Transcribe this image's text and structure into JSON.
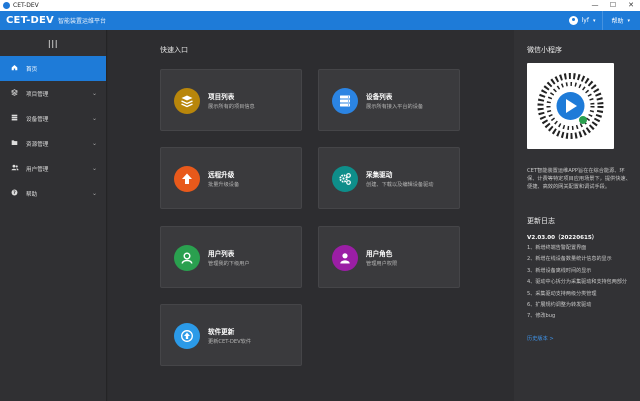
{
  "window": {
    "title": "CET-DEV",
    "minimize": "—",
    "maximize": "☐",
    "close": "✕"
  },
  "header": {
    "logo": "CET-DEV",
    "subtitle": "智能装置运维平台",
    "user": "lyf",
    "help": "帮助",
    "accent": "#1e7bd8"
  },
  "sidebar": {
    "collapse_glyph": "|||",
    "items": [
      {
        "label": "首页",
        "icon": "home-icon",
        "active": true,
        "has_children": false
      },
      {
        "label": "项目管理",
        "icon": "layers-icon",
        "active": false,
        "has_children": true
      },
      {
        "label": "设备管理",
        "icon": "server-icon",
        "active": false,
        "has_children": true
      },
      {
        "label": "资源管理",
        "icon": "folder-icon",
        "active": false,
        "has_children": true
      },
      {
        "label": "用户管理",
        "icon": "users-icon",
        "active": false,
        "has_children": true
      },
      {
        "label": "帮助",
        "icon": "help-icon",
        "active": false,
        "has_children": true
      }
    ]
  },
  "quick": {
    "title": "快速入口",
    "cards": [
      {
        "name": "项目列表",
        "desc": "展示所有的项目信息",
        "icon": "layers-icon",
        "color": "#b8860b"
      },
      {
        "name": "设备列表",
        "desc": "展示所有接入平台的设备",
        "icon": "server-icon",
        "color": "#2b84e3"
      },
      {
        "name": "远程升级",
        "desc": "批量升级设备",
        "icon": "upload-icon",
        "color": "#e8591b"
      },
      {
        "name": "采集驱动",
        "desc": "创建、下载以及编辑设备驱动",
        "icon": "gears-icon",
        "color": "#0e8e8a"
      },
      {
        "name": "用户列表",
        "desc": "管理我的下级用户",
        "icon": "user-icon",
        "color": "#2aa04f"
      },
      {
        "name": "用户角色",
        "desc": "管理用户权限",
        "icon": "user-icon",
        "color": "#9b1ea5"
      },
      {
        "name": "软件更新",
        "desc": "更新CET-DEV软件",
        "icon": "update-icon",
        "color": "#2b9ae8"
      }
    ]
  },
  "right": {
    "mini_title": "微信小程序",
    "mini_desc": "CET智能装置运维APP旨在在综合能源、环保、计费等特定项目应用场景下，提供快速、便捷、高效的网关配置和调试手段。",
    "log_title": "更新日志",
    "version": "V2.03.00（20220615）",
    "changes": [
      "1、新增终端告警配置界面",
      "2、新增在线设备数量统计信息的显示",
      "3、新增设备离线时间的显示",
      "4、驱动中心拆分为采集驱动和支持包两部分",
      "5、采集驱动支持两级分类管理",
      "6、扩展规约调整为转发驱动",
      "7、修改bug"
    ],
    "history": "历史版本 >"
  }
}
